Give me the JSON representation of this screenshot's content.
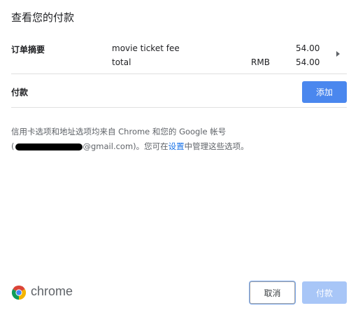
{
  "dialog": {
    "title": "查看您的付款"
  },
  "order_summary": {
    "label": "订单摘要",
    "items": [
      {
        "name": "movie ticket fee",
        "currency": "",
        "amount": "54.00"
      }
    ],
    "total": {
      "name": "total",
      "currency": "RMB",
      "amount": "54.00"
    },
    "expand_icon": "triangle-right-icon"
  },
  "payment": {
    "label": "付款",
    "add_button": "添加"
  },
  "info": {
    "line1": "信用卡选项和地址选项均来自 Chrome 和您的 Google 帐号",
    "email_open": "(",
    "email_suffix": "@gmail.com)。您可在",
    "settings_link": "设置",
    "line2_tail": "中管理这些选项。"
  },
  "footer": {
    "brand_word": "chrome",
    "brand_icon": "chrome-logo-icon",
    "cancel_button": "取消",
    "pay_button": "付款"
  },
  "colors": {
    "primary_button": "#4a87ee",
    "disabled_button": "#a8c6f7",
    "link": "#1a73e8"
  }
}
